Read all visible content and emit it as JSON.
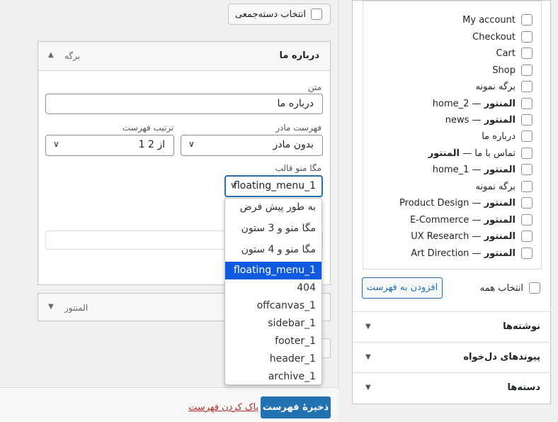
{
  "left": {
    "bulk_select_label": "انتخاب دسته‌جمعی",
    "item": {
      "title": "درباره ما",
      "type": "برگه",
      "toggle_arrow": "▲",
      "nav_label_label": "متن",
      "nav_label_value": "درباره ما",
      "parent_label": "فهرست مادر",
      "parent_value": "بدون مادر",
      "order_label": "ترتیب فهرست",
      "order_value": "1 از 2",
      "mega_label": "مگا منو قالب",
      "mega_value": "floating_menu_1"
    },
    "elementor_box": {
      "title": "المنتور",
      "arrow": "▼"
    },
    "footer": {
      "save_label": "ذخیرهٔ فهرست",
      "delete_label": "پاک کردن فهرست"
    }
  },
  "dropdown": {
    "options": [
      "به طور پیش فرض",
      "مگا منو و 3 ستون",
      "مگا منو و 4 ستون",
      "floating_menu_1",
      "404",
      "offcanvas_1",
      "sidebar_1",
      "footer_1",
      "header_1",
      "archive_1"
    ],
    "selected_index": 3
  },
  "right": {
    "pages": [
      {
        "label": "My account",
        "suffix": ""
      },
      {
        "label": "Checkout",
        "suffix": ""
      },
      {
        "label": "Cart",
        "suffix": ""
      },
      {
        "label": "Shop",
        "suffix": ""
      },
      {
        "label": "برگه نمونه",
        "suffix": ""
      },
      {
        "label": "home_2 — ",
        "suffix": "المنتور"
      },
      {
        "label": "news — ",
        "suffix": "المنتور"
      },
      {
        "label": "درباره ما",
        "suffix": ""
      },
      {
        "label": "تماس با ما — ",
        "suffix": "المنتور"
      },
      {
        "label": "home_1 — ",
        "suffix": "المنتور"
      },
      {
        "label": "برگه نمونه",
        "suffix": ""
      },
      {
        "label": "Product Design — ",
        "suffix": "المنتور"
      },
      {
        "label": "E-Commerce — ",
        "suffix": "المنتور"
      },
      {
        "label": "UX Research — ",
        "suffix": "المنتور"
      },
      {
        "label": "Art Direction — ",
        "suffix": "المنتور"
      }
    ],
    "select_all_label": "انتخاب همه",
    "add_button_label": "افزودن به فهرست",
    "accordions": [
      {
        "title": "نوشته‌ها"
      },
      {
        "title": "پیوندهای دل‌خواه"
      },
      {
        "title": "دسته‌ها"
      }
    ]
  }
}
